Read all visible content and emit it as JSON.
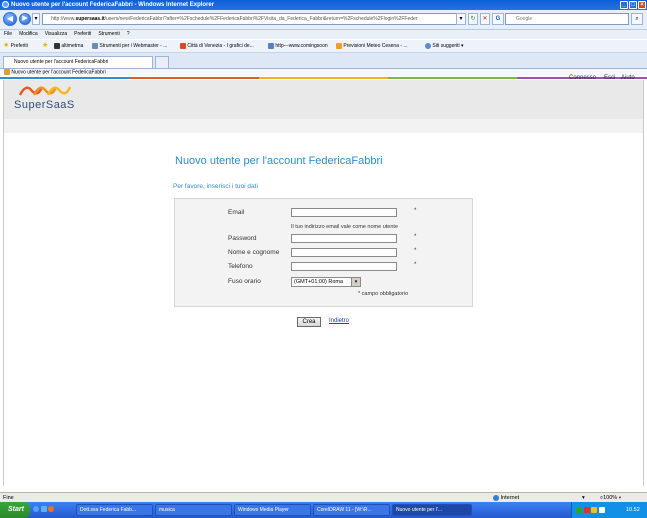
{
  "window": {
    "title": "Nuovo utente per l'account FedericaFabbri - Windows Internet Explorer",
    "min": "_",
    "max": "□",
    "close": "×"
  },
  "browser": {
    "address": "http://www.supersaas.it/users/new/FedericaFabbri?after=%2Fschedule%2FFedericaFabbri%2FVisita_da_Federica_Fabbri&return=%2Fschedule%2Flogin%2FFeder",
    "address_prefix": "http://www.",
    "address_host": "supersaas.it",
    "address_path": "/users/new/FedericaFabbri?after=%2Fschedule%2FFedericaFabbri%2FVisita_da_Federica_Fabbri&return=%2Fschedule%2Flogin%2FFeder",
    "search_placeholder": "Google",
    "menu": [
      "File",
      "Modifica",
      "Visualizza",
      "Preferiti",
      "Strumenti",
      "?"
    ],
    "favorites_label": "Preferiti",
    "favorites": [
      "altimetrna",
      "Strumenti per i Webmaster - ...",
      "Città di Venezia - I grafici de...",
      "http---www.comingsoon",
      "Previsioni Meteo Cesena - ...",
      "Siti suggeriti ▾"
    ],
    "tab_title": "Nuovo utente per l'account FedericaFabbri",
    "command_tab": "Nuovo utente per l'account FedericaFabbri"
  },
  "site": {
    "logo": "SuperSaaS",
    "links": [
      "Connesso",
      "Esci",
      "Aiuto"
    ]
  },
  "page": {
    "title": "Nuovo utente per l'account FedericaFabbri",
    "subtitle": "Per favore, inserisci i tuoi dati",
    "fields": {
      "email_label": "Email",
      "email_hint": "Il tuo indirizzo email vale come nome utente",
      "password_label": "Password",
      "name_label": "Nome e cognome",
      "phone_label": "Telefono",
      "tz_label": "Fuso orario",
      "tz_value": "(GMT+01:00) Roma",
      "required_mark": "*"
    },
    "required_note": "* campo obbligatorio",
    "submit_label": "Crea",
    "back_label": "Indietro"
  },
  "status": {
    "text": "Fine",
    "zone": "Internet",
    "zoom": "100%"
  },
  "taskbar": {
    "start": "Start",
    "items": [
      "Dott.ssa Federica Fabb...",
      "musica",
      "Windows Media Player",
      "CorelDRAW 11 - [W:\\R...",
      "Nuovo utente per l'..."
    ],
    "clock": "10.52"
  }
}
